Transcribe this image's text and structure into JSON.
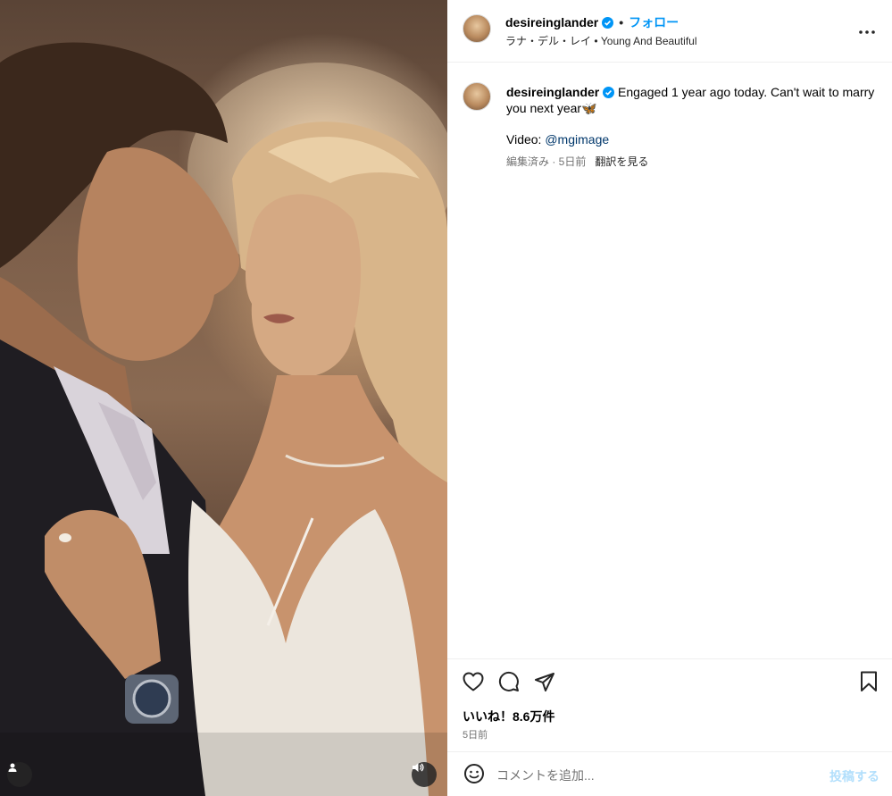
{
  "post": {
    "username": "desireinglander",
    "verified": true,
    "follow_label": "フォロー",
    "audio": "ラナ・デル・レイ • Young And Beautiful",
    "more_icon": "more-horizontal-icon"
  },
  "caption": {
    "username": "desireinglander",
    "text": "Engaged 1 year ago today. Can't wait to marry you next year🦋",
    "video_label": "Video: ",
    "video_mention": "@mgimage",
    "meta": "編集済み · 5日前",
    "translate_label": "翻訳を見る"
  },
  "actions": {
    "icons": [
      "heart-icon",
      "comment-icon",
      "share-icon",
      "bookmark-icon"
    ],
    "likes": "いいね！8.6万件",
    "time": "5日前"
  },
  "comment": {
    "placeholder": "コメントを追加...",
    "post_label": "投稿する"
  },
  "media": {
    "type": "video",
    "description_icons": [
      "user-tag-icon",
      "audio-icon"
    ]
  },
  "colors": {
    "follow": "#0095f6",
    "link": "#00376b",
    "muted": "#737373",
    "post_button_disabled": "#b2dffc",
    "verified": "#0095f6"
  }
}
